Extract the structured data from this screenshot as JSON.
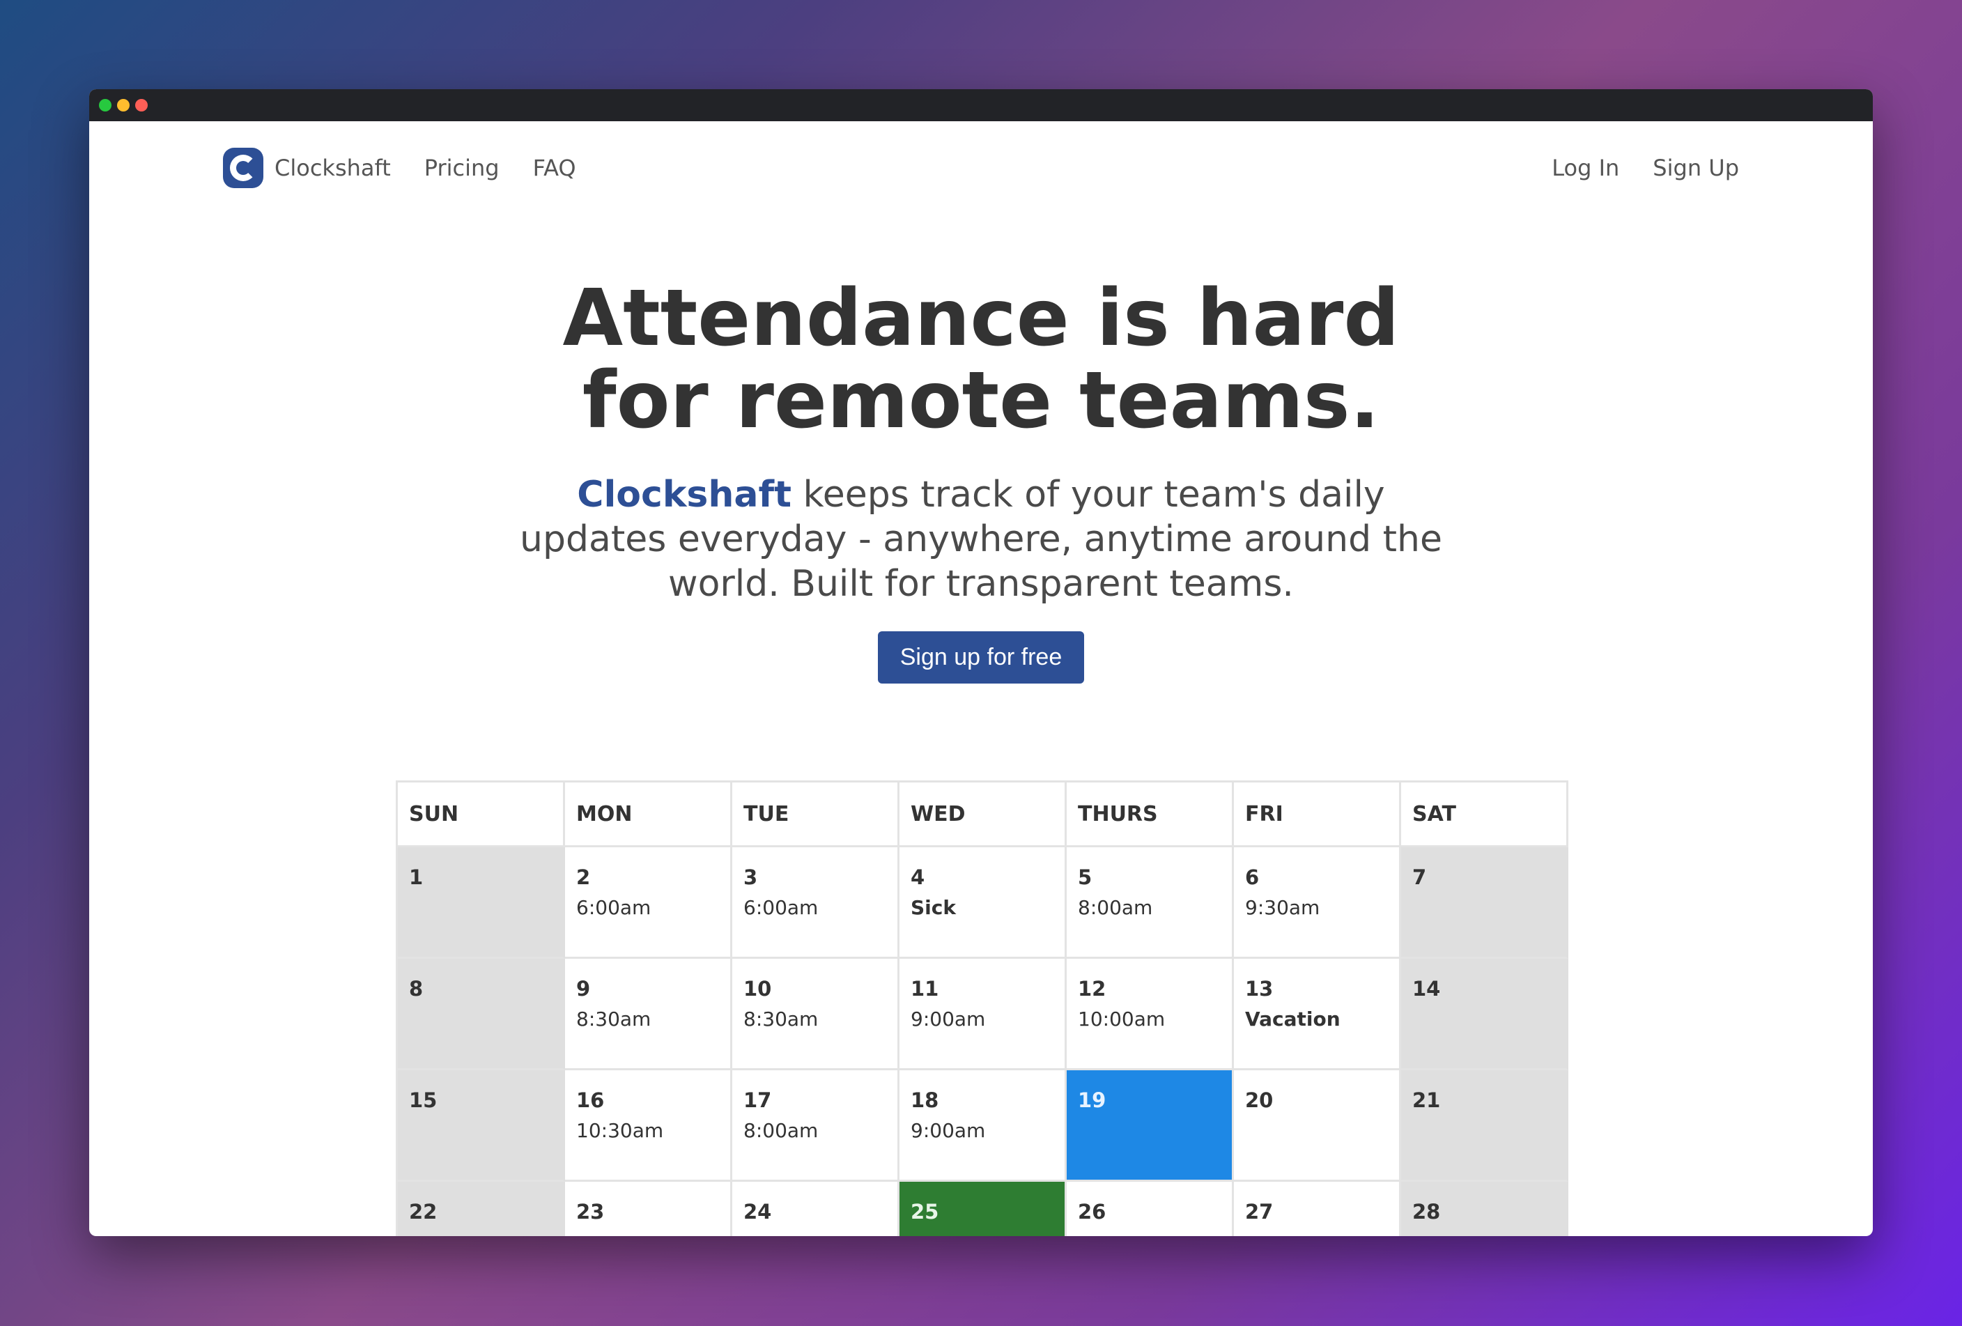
{
  "window": {
    "traffic_lights": [
      "#27c93f",
      "#ffbd2e",
      "#ff5f57"
    ]
  },
  "nav": {
    "brand": "Clockshaft",
    "links": [
      "Pricing",
      "FAQ"
    ],
    "login": "Log In",
    "signup": "Sign Up"
  },
  "hero": {
    "title": "Attendance is hard for remote teams.",
    "brand_highlight": "Clockshaft",
    "subtitle": " keeps track of your team's daily updates everyday - anywhere, anytime around the world. Built for transparent teams.",
    "cta": "Sign up for free"
  },
  "colors": {
    "brand": "#2d4f95",
    "today": "#1e88e5",
    "event": "#2e7d32"
  },
  "calendar": {
    "headers": [
      "SUN",
      "MON",
      "TUE",
      "WED",
      "THURS",
      "FRI",
      "SAT"
    ],
    "weeks": [
      [
        {
          "day": "1",
          "note": "",
          "kind": "weekend"
        },
        {
          "day": "2",
          "note": "6:00am"
        },
        {
          "day": "3",
          "note": "6:00am"
        },
        {
          "day": "4",
          "note": "Sick",
          "bold": true
        },
        {
          "day": "5",
          "note": "8:00am"
        },
        {
          "day": "6",
          "note": "9:30am"
        },
        {
          "day": "7",
          "note": "",
          "kind": "weekend"
        }
      ],
      [
        {
          "day": "8",
          "note": "",
          "kind": "weekend"
        },
        {
          "day": "9",
          "note": "8:30am"
        },
        {
          "day": "10",
          "note": "8:30am"
        },
        {
          "day": "11",
          "note": "9:00am"
        },
        {
          "day": "12",
          "note": "10:00am"
        },
        {
          "day": "13",
          "note": "Vacation",
          "bold": true
        },
        {
          "day": "14",
          "note": "",
          "kind": "weekend"
        }
      ],
      [
        {
          "day": "15",
          "note": "",
          "kind": "weekend"
        },
        {
          "day": "16",
          "note": "10:30am"
        },
        {
          "day": "17",
          "note": "8:00am"
        },
        {
          "day": "18",
          "note": "9:00am"
        },
        {
          "day": "19",
          "note": "",
          "kind": "today"
        },
        {
          "day": "20",
          "note": ""
        },
        {
          "day": "21",
          "note": "",
          "kind": "weekend"
        }
      ],
      [
        {
          "day": "22",
          "note": "",
          "kind": "weekend"
        },
        {
          "day": "23",
          "note": ""
        },
        {
          "day": "24",
          "note": ""
        },
        {
          "day": "25",
          "note": "",
          "kind": "event"
        },
        {
          "day": "26",
          "note": ""
        },
        {
          "day": "27",
          "note": ""
        },
        {
          "day": "28",
          "note": "",
          "kind": "weekend"
        }
      ]
    ]
  }
}
